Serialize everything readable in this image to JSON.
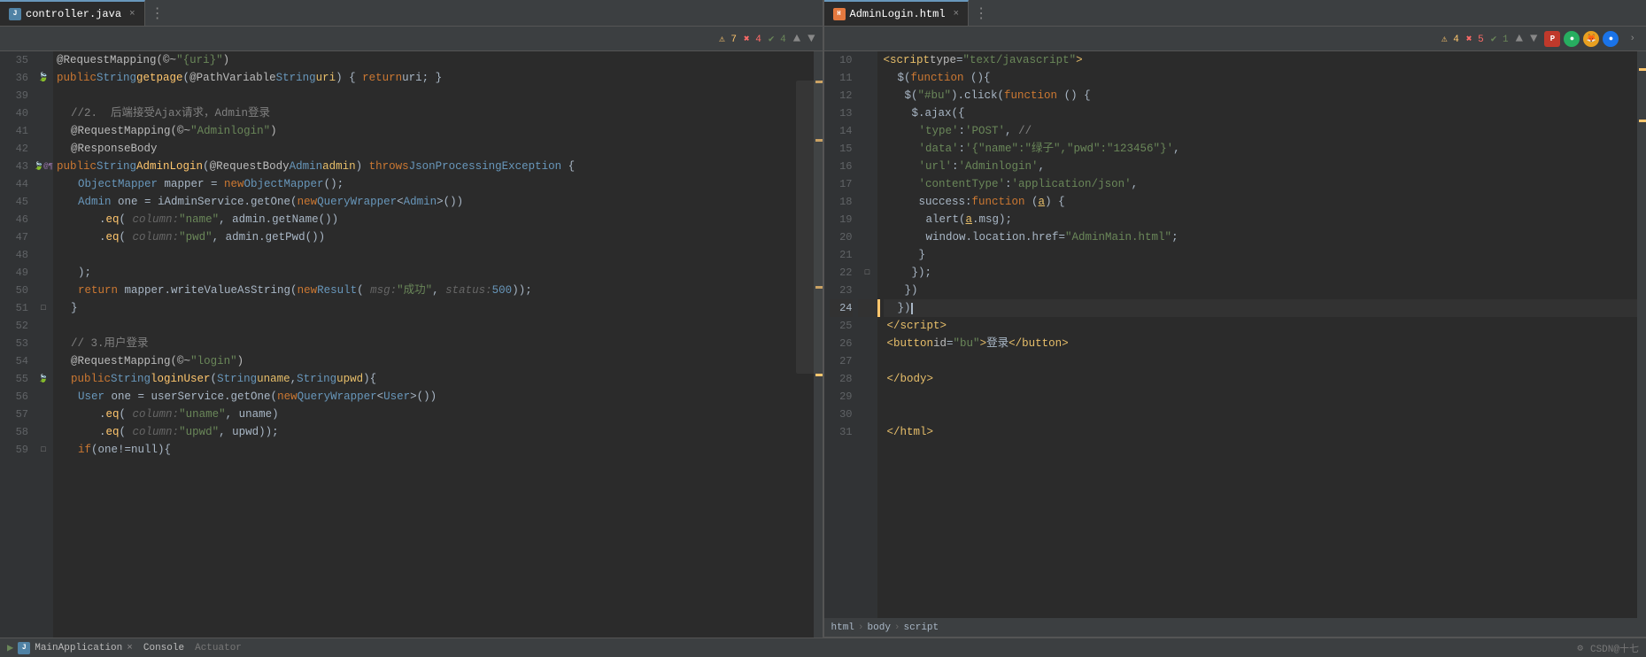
{
  "tabs": {
    "left": {
      "label": "controller.java",
      "icon_type": "java",
      "active": true
    },
    "right": {
      "label": "AdminLogin.html",
      "icon_type": "html",
      "active": true
    }
  },
  "left_editor": {
    "title": "controller.java",
    "warnings": 7,
    "errors": 4,
    "ok": 4,
    "lines": [
      {
        "num": 35,
        "content_html": "<span class='ann'>@RequestMapping(</span><span class='ann-val'>©</span><span class='white'>~</span><span class='str'>\"{uri}\"</span><span class='ann'>)</span>"
      },
      {
        "num": 36,
        "gutter": "leaf",
        "content_html": "<span class='kw'>public</span> <span class='type'>String</span> <span class='fn'>getpage</span>(<span class='ann'>@PathVariable</span> <span class='type'>String</span> <span class='param'>uri</span>) { <span class='kw'>return</span> uri; }"
      },
      {
        "num": 39,
        "content_html": ""
      },
      {
        "num": 40,
        "content_html": "    <span class='comment'>//2.  后端接受Ajax请求，Admin登录</span>"
      },
      {
        "num": 41,
        "content_html": "    <span class='ann'>@RequestMapping(</span><span class='ann-val'>©</span><span class='white'>~</span><span class='str'>\"Adminlogin\"</span><span class='ann'>)</span>"
      },
      {
        "num": 42,
        "content_html": "    <span class='ann'>@ResponseBody</span>"
      },
      {
        "num": 43,
        "gutter": "multi",
        "content_html": "<span class='kw'>public</span> <span class='type'>String</span>   <span class='fn'>AdminLogin</span>(<span class='ann'>@RequestBody</span> <span class='type'>Admin</span> <span class='param'>admin</span>) <span class='kw'>throws</span> <span class='type'>JsonProcessingException</span> {"
      },
      {
        "num": 44,
        "content_html": "        <span class='type'>ObjectMapper</span> mapper = <span class='kw'>new</span> <span class='type'>ObjectMapper</span>();"
      },
      {
        "num": 45,
        "content_html": "        <span class='type'>Admin</span> one = iAdminService.getOne(<span class='kw'>new</span> <span class='type'>QueryWrapper</span>&lt;<span class='type'>Admin</span>&gt;())"
      },
      {
        "num": 46,
        "content_html": "                .<span class='fn'>eq</span>( <span class='hint'>column:</span> <span class='str'>\"name\"</span>, admin.getName())"
      },
      {
        "num": 47,
        "content_html": "                .<span class='fn'>eq</span>( <span class='hint'>column:</span> <span class='str'>\"pwd\"</span>, admin.getPwd())"
      },
      {
        "num": 48,
        "content_html": ""
      },
      {
        "num": 49,
        "content_html": "        );"
      },
      {
        "num": 50,
        "content_html": "        <span class='kw'>return</span> mapper.writeValueAsString(<span class='kw'>new</span> <span class='type'>Result</span>( <span class='hint'>msg:</span> <span class='str'>\"成功\"</span>, <span class='hint'>status:</span> <span class='num'>500</span>));"
      },
      {
        "num": 51,
        "gutter": "fold",
        "content_html": "    }"
      },
      {
        "num": 52,
        "content_html": ""
      },
      {
        "num": 53,
        "content_html": "    <span class='comment'>// 3.用户登录</span>"
      },
      {
        "num": 54,
        "content_html": "    <span class='ann'>@RequestMapping(</span><span class='ann-val'>©</span><span class='white'>~</span><span class='str'>\"login\"</span><span class='ann'>)</span>"
      },
      {
        "num": 55,
        "gutter": "leaf",
        "content_html": "    <span class='kw'>public</span> <span class='type'>String</span> <span class='fn'>loginUser</span>(<span class='type'>String</span> <span class='param'>uname</span>,<span class='type'>String</span> <span class='param'>upwd</span>){"
      },
      {
        "num": 56,
        "content_html": "        <span class='type'>User</span> one = userService.getOne(<span class='kw'>new</span> <span class='type'>QueryWrapper</span>&lt;<span class='type'>User</span>&gt;())"
      },
      {
        "num": 57,
        "content_html": "                .<span class='fn'>eq</span>( <span class='hint'>column:</span> <span class='str'>\"uname\"</span>, uname)"
      },
      {
        "num": 58,
        "content_html": "                .<span class='fn'>eq</span>( <span class='hint'>column:</span> <span class='str'>\"upwd\"</span>, upwd));"
      },
      {
        "num": 59,
        "gutter": "fold",
        "content_html": "        <span class='kw'>if</span>(one!=null){"
      }
    ]
  },
  "right_editor": {
    "title": "AdminLogin.html",
    "warnings": 4,
    "errors": 5,
    "ok": 1,
    "lines": [
      {
        "num": 10,
        "content_html": "    <span class='tag'>&lt;script</span> <span class='attr'>type</span>=<span class='attr-val'>\"text/javascript\"</span><span class='tag'>&gt;</span>"
      },
      {
        "num": 11,
        "content_html": "        $(<span class='js-fn'>function</span> (){"
      },
      {
        "num": 12,
        "content_html": "            $(<span class='js-str'>\"#bu\"</span>).click(<span class='js-fn'>function</span> () {"
      },
      {
        "num": 13,
        "content_html": "                $.ajax({"
      },
      {
        "num": 14,
        "content_html": "                    <span class='js-prop'>'type'</span>:<span class='js-str'>'POST'</span>, <span class='comment'>//</span>"
      },
      {
        "num": 15,
        "content_html": "                    <span class='js-prop'>'data'</span>:<span class='js-str'>'{\"name\":\"绿子\",\"pwd\":\"123456\"}'</span>,"
      },
      {
        "num": 16,
        "content_html": "                    <span class='js-prop'>'url'</span>:<span class='js-str'>'Adminlogin'</span>,"
      },
      {
        "num": 17,
        "content_html": "                    <span class='js-prop'>'contentType'</span>:<span class='js-str'>'application/json'</span>,"
      },
      {
        "num": 18,
        "content_html": "                    success:<span class='js-fn'>function</span> (<span class='js-param'><span class='underline'>a</span></span>) {"
      },
      {
        "num": 19,
        "content_html": "                        alert(<span class='js-param'><span class='underline'>a</span></span>.msg);"
      },
      {
        "num": 20,
        "content_html": "                        window.location.href=<span class='js-str'>\"AdminMain.html\"</span>;"
      },
      {
        "num": 21,
        "content_html": "                    }"
      },
      {
        "num": 22,
        "content_html": "                });"
      },
      {
        "num": 23,
        "content_html": "            })"
      },
      {
        "num": 24,
        "content_html": "        })<span class='cursor'></span>",
        "current": true
      },
      {
        "num": 25,
        "content_html": "    <span class='tag'>&lt;/script&gt;</span>"
      },
      {
        "num": 26,
        "content_html": "    <span class='tag'>&lt;button</span> <span class='attr'>id</span>=<span class='attr-val'>\"bu\"</span><span class='tag'>&gt;</span>登录<span class='tag'>&lt;/button&gt;</span>"
      },
      {
        "num": 27,
        "content_html": ""
      },
      {
        "num": 28,
        "content_html": "    <span class='tag'>&lt;/body&gt;</span>"
      },
      {
        "num": 29,
        "content_html": ""
      },
      {
        "num": 30,
        "content_html": ""
      },
      {
        "num": 31,
        "content_html": "    <span class='tag'>&lt;/html&gt;</span>"
      }
    ]
  },
  "breadcrumb": {
    "items": [
      "html",
      "body",
      "script"
    ]
  },
  "bottom_bar": {
    "run_label": "MainApplication",
    "tabs": [
      "Console",
      "Actuator"
    ],
    "right_text": "CSDN@十七"
  },
  "plugin_icons": {
    "icon1_color": "#c0392b",
    "icon2_color": "#27ae60",
    "icon3_color": "#2980b9",
    "icon4_color": "#1a73e8"
  }
}
